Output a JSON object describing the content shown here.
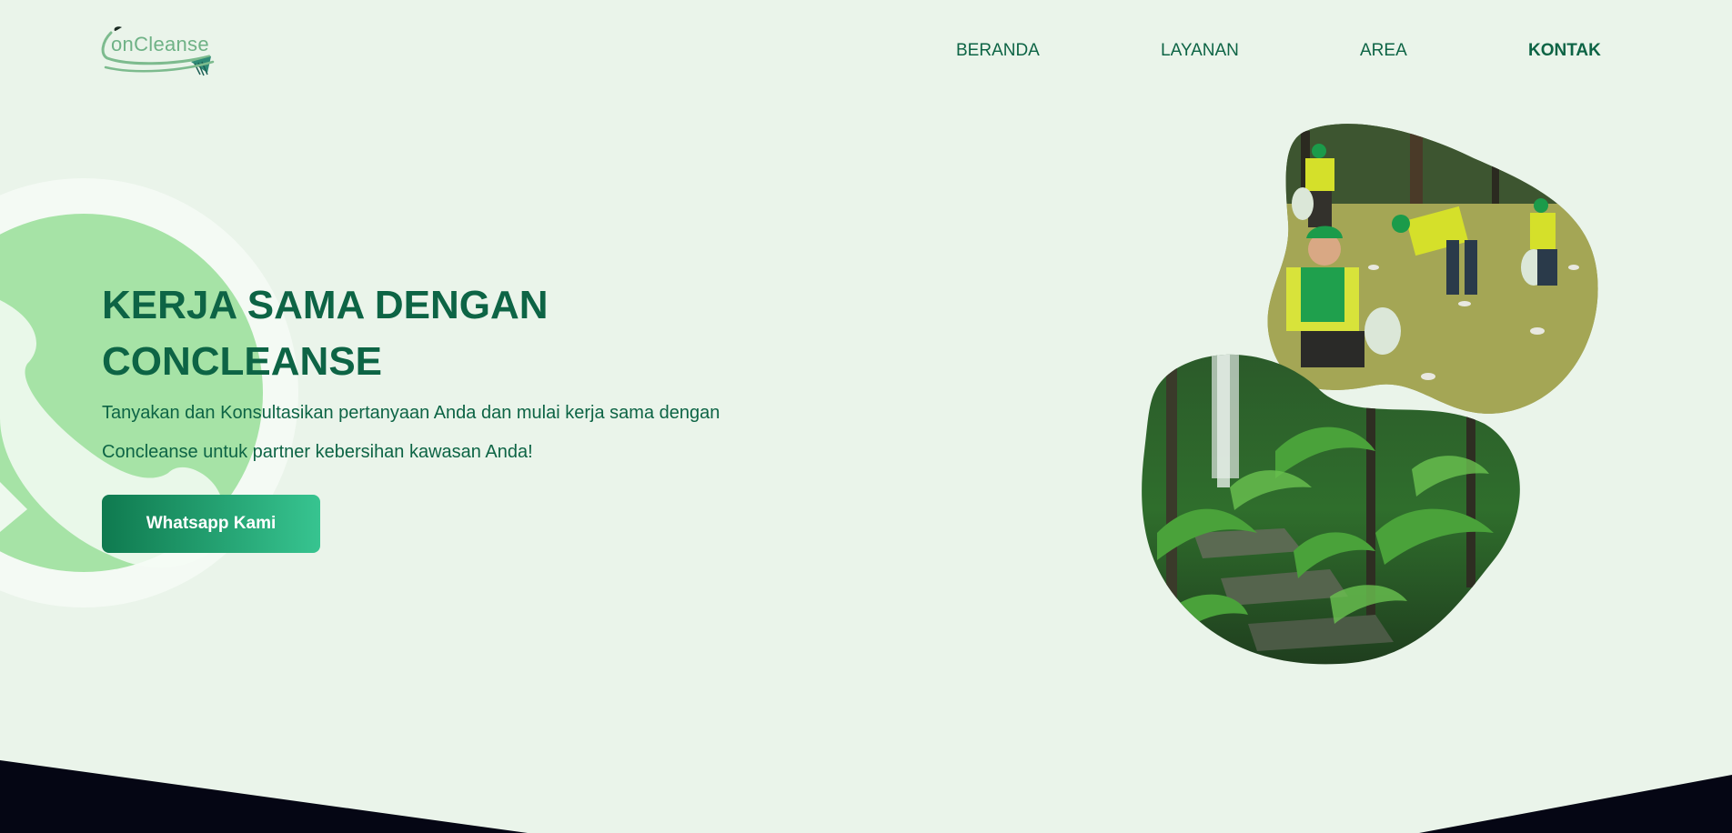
{
  "brand": {
    "logo_text": "onCleanse",
    "logo_mark": "C",
    "primary_color": "#0d6445",
    "accent_color": "#37c490",
    "background_color": "#eaf4ea",
    "whatsapp_green": "#a6e3a6"
  },
  "nav": {
    "items": [
      {
        "label": "BERANDA",
        "active": false
      },
      {
        "label": "LAYANAN",
        "active": false
      },
      {
        "label": "AREA",
        "active": false
      },
      {
        "label": "KONTAK",
        "active": true
      }
    ]
  },
  "hero": {
    "title": "KERJA SAMA DENGAN CONCLEANSE",
    "description": "Tanyakan dan Konsultasikan pertanyaan Anda dan mulai kerja sama dengan Concleanse untuk partner kebersihan kawasan Anda!",
    "button_label": "Whatsapp Kami",
    "background_icon": "whatsapp-icon"
  },
  "images": {
    "top_photo": "volunteers-cleaning-park-photo",
    "bottom_photo": "forest-ferns-waterfall-photo"
  },
  "footer": {
    "color": "#050614"
  }
}
